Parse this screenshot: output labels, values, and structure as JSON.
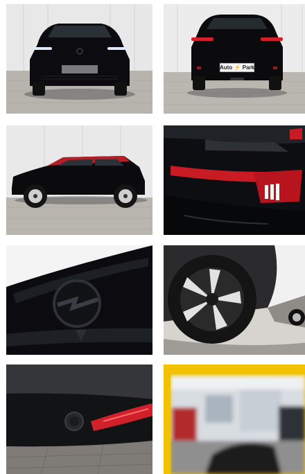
{
  "gallery": {
    "tiles": [
      {
        "subject": "front-view"
      },
      {
        "subject": "rear-view",
        "plate_text": "Auto ⚡ Park"
      },
      {
        "subject": "side-view"
      },
      {
        "subject": "tail-light-detail"
      },
      {
        "subject": "front-logo-detail"
      },
      {
        "subject": "wheel-detail"
      },
      {
        "subject": "rear-sensor-detail"
      },
      {
        "subject": "dealership-interior-blurred"
      }
    ]
  },
  "colors": {
    "car_body": "#0b0b0e",
    "accent_red": "#d2202a",
    "wall": "#e9e9e9",
    "paving": "#b8b5b0",
    "dealer_frame": "#f2c200"
  }
}
